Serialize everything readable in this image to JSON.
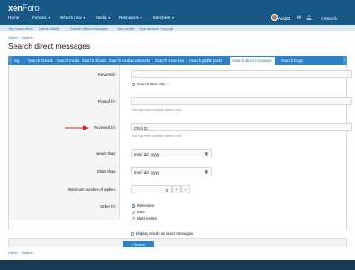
{
  "header": {
    "logo_bold": "xen",
    "logo_rest": "Foro",
    "nav": [
      {
        "label": "Home",
        "dropdown": false
      },
      {
        "label": "Forums",
        "dropdown": true
      },
      {
        "label": "What's new",
        "dropdown": true
      },
      {
        "label": "Media",
        "dropdown": true
      },
      {
        "label": "Resources",
        "dropdown": true
      },
      {
        "label": "Members",
        "dropdown": true
      }
    ],
    "user_name": "AndyB",
    "search_label": "Search"
  },
  "subnav": [
    "Your news feed",
    "Latest activity",
    "Search direct messages",
    "Your profile",
    "Your account",
    "Log out"
  ],
  "breadcrumb": {
    "home": "Home",
    "current": "Search"
  },
  "page_title": "Search direct messages",
  "tabs": [
    "ing",
    "Search threads",
    "Search media",
    "Search albums",
    "Search media comments",
    "Search resources",
    "Search profile posts",
    "Search direct messages",
    "Search blogs"
  ],
  "active_tab_index": 7,
  "form": {
    "keywords_label": "Keywords:",
    "keywords_value": "",
    "titles_only_label": "Search titles only",
    "posted_by_label": "Posted by:",
    "posted_by_value": "",
    "posted_by_hint": "You may enter multiple names here.",
    "received_by_label": "Received by:",
    "received_by_value": "Chris D.",
    "received_by_hint": "You may enter multiple names here.",
    "newer_than_label": "Newer than:",
    "newer_than_placeholder": "mm / dd / yyyy",
    "older_than_label": "Older than:",
    "older_than_placeholder": "mm / dd / yyyy",
    "min_replies_label": "Minimum number of replies:",
    "min_replies_value": "0",
    "stepper_plus": "+",
    "stepper_minus": "−",
    "order_by_label": "Order by:",
    "order_options": [
      "Relevance",
      "Date",
      "Most replies"
    ],
    "order_selected": "Relevance",
    "display_results_label": "Display results as direct messages",
    "submit_label": "Search"
  },
  "colors": {
    "header_bg": "#185886",
    "tab_bar": "#2f81c6",
    "link": "#2577b1",
    "annotation_arrow": "#d42020"
  }
}
